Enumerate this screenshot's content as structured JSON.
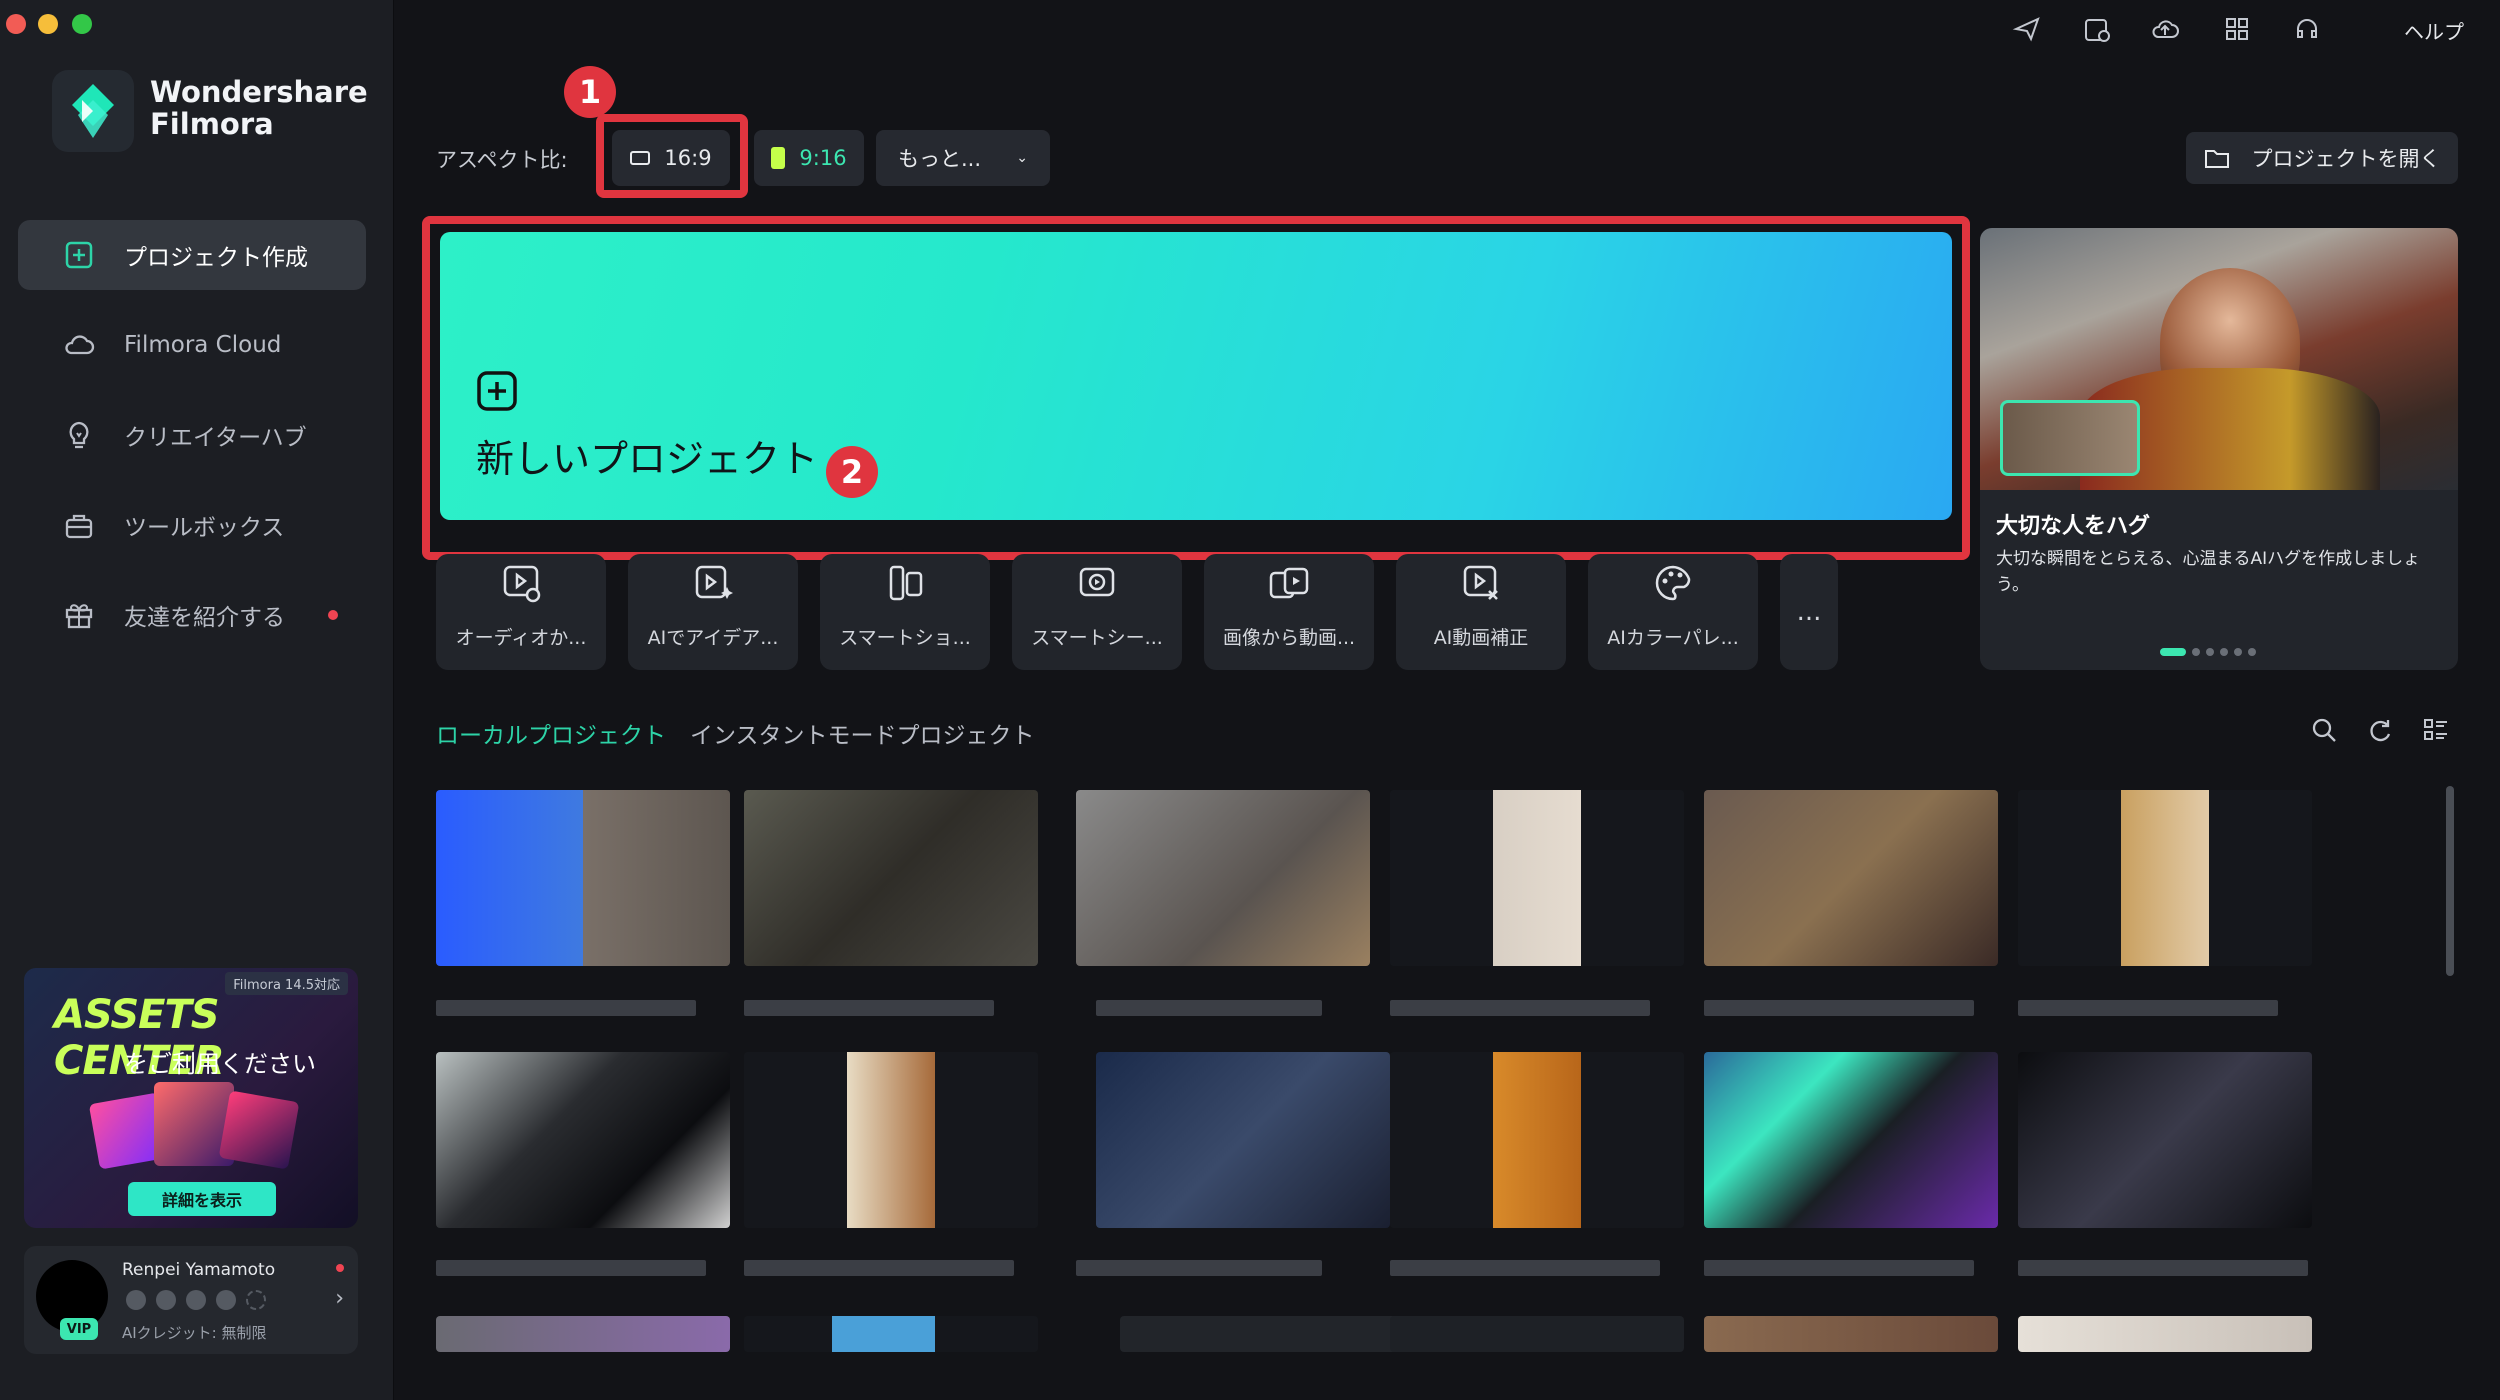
{
  "app": {
    "name_line1": "Wondershare",
    "name_line2": "Filmora"
  },
  "sidebar": {
    "items": [
      {
        "label": "プロジェクト作成",
        "icon": "plus-square-icon",
        "active": true
      },
      {
        "label": "Filmora Cloud",
        "icon": "cloud-icon"
      },
      {
        "label": "クリエイターハブ",
        "icon": "lightbulb-icon"
      },
      {
        "label": "ツールボックス",
        "icon": "toolbox-icon"
      },
      {
        "label": "友達を紹介する",
        "icon": "gift-icon",
        "dot": true
      }
    ],
    "assets_card": {
      "version_tag": "Filmora 14.5対応",
      "title": "ASSETS CENTER",
      "subtitle": "をご利用ください",
      "button": "詳細を表示"
    },
    "profile": {
      "name": "Renpei Yamamoto",
      "badge": "VIP",
      "credits": "AIクレジット: 無制限"
    }
  },
  "topbar": {
    "help": "ヘルプ",
    "icons": [
      "send-icon",
      "calendar-clock-icon",
      "cloud-upload-icon",
      "grid-icon",
      "headset-icon"
    ]
  },
  "aspect": {
    "label": "アスペクト比:",
    "options": [
      "16:9",
      "9:16"
    ],
    "more": "もっと...",
    "open_project": "プロジェクトを開く"
  },
  "hero": {
    "label": "新しいプロジェクト"
  },
  "annotations": {
    "badge1": "1",
    "badge2": "2",
    "color": "#e0353f"
  },
  "tools": [
    {
      "label": "オーディオか...",
      "icon": "audio-to-video-icon"
    },
    {
      "label": "AIでアイデア...",
      "icon": "ai-idea-icon"
    },
    {
      "label": "スマートショ...",
      "icon": "smart-short-icon"
    },
    {
      "label": "スマートシー...",
      "icon": "smart-scene-icon"
    },
    {
      "label": "画像から動画...",
      "icon": "image-to-video-icon"
    },
    {
      "label": "AI動画補正",
      "icon": "ai-enhance-icon"
    },
    {
      "label": "AIカラーパレ...",
      "icon": "ai-palette-icon"
    }
  ],
  "tools_more": "...",
  "promo": {
    "title": "大切な人をハグ",
    "desc": "大切な瞬間をとらえる、心温まるAIハグを作成しましょう。",
    "slides": 6,
    "active_slide": 0
  },
  "projects": {
    "tabs": [
      "ローカルプロジェクト",
      "インスタントモードプロジェクト"
    ],
    "active_tab": 0,
    "accent": "#2dd4a8"
  }
}
